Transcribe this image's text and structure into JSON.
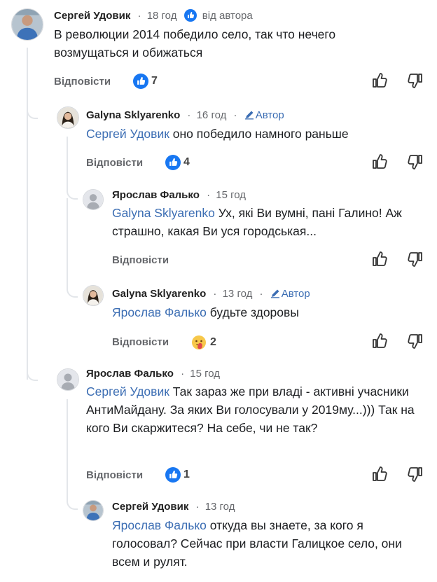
{
  "labels": {
    "reply": "Відповісти",
    "from_author": "від автора",
    "author": "Автор"
  },
  "comments": [
    {
      "name": "Сергей Удовик",
      "age": "18 год",
      "text": "В революции 2014 победило село, так что нечего возмущаться и обижаться",
      "reaction_count": "7"
    },
    {
      "name": "Galyna  Sklyarenko",
      "age": "16 год",
      "mention": "Сергей Удовик",
      "text": "оно победило намного раньше",
      "reaction_count": "4"
    },
    {
      "name": "Ярослав Фалько",
      "age": "15 год",
      "mention": "Galyna  Sklyarenko",
      "text": "Ух, які Ви вумні, пані Галино! Аж страшно, какая Ви уся городськая..."
    },
    {
      "name": "Galyna  Sklyarenko",
      "age": "13 год",
      "mention": "Ярослав Фалько",
      "text": "будьте здоровы",
      "reaction_count": "2"
    },
    {
      "name": "Ярослав Фалько",
      "age": "15 год",
      "mention": "Сергей Удовик",
      "text": "Так зараз же при владі - активні учасники АнтиМайдану. За яких Ви голосували у 2019му...))) Так на кого Ви скаржитеся? На себе, чи не так?",
      "reaction_count": "1"
    },
    {
      "name": "Сергей Удовик",
      "age": "13 год",
      "mention": "Ярослав Фалько",
      "text": "откуда вы знаете, за кого я голосовал? Сейчас при власти Галицкое село, они всем и рулят."
    }
  ],
  "colors": {
    "link": "#3b6db3",
    "like": "#1877f2",
    "muted": "#65676b"
  },
  "icons": [
    "like-icon",
    "thumbs-up-icon",
    "thumbs-down-icon",
    "pen-icon",
    "hug-emoji-icon",
    "default-avatar-icon"
  ]
}
